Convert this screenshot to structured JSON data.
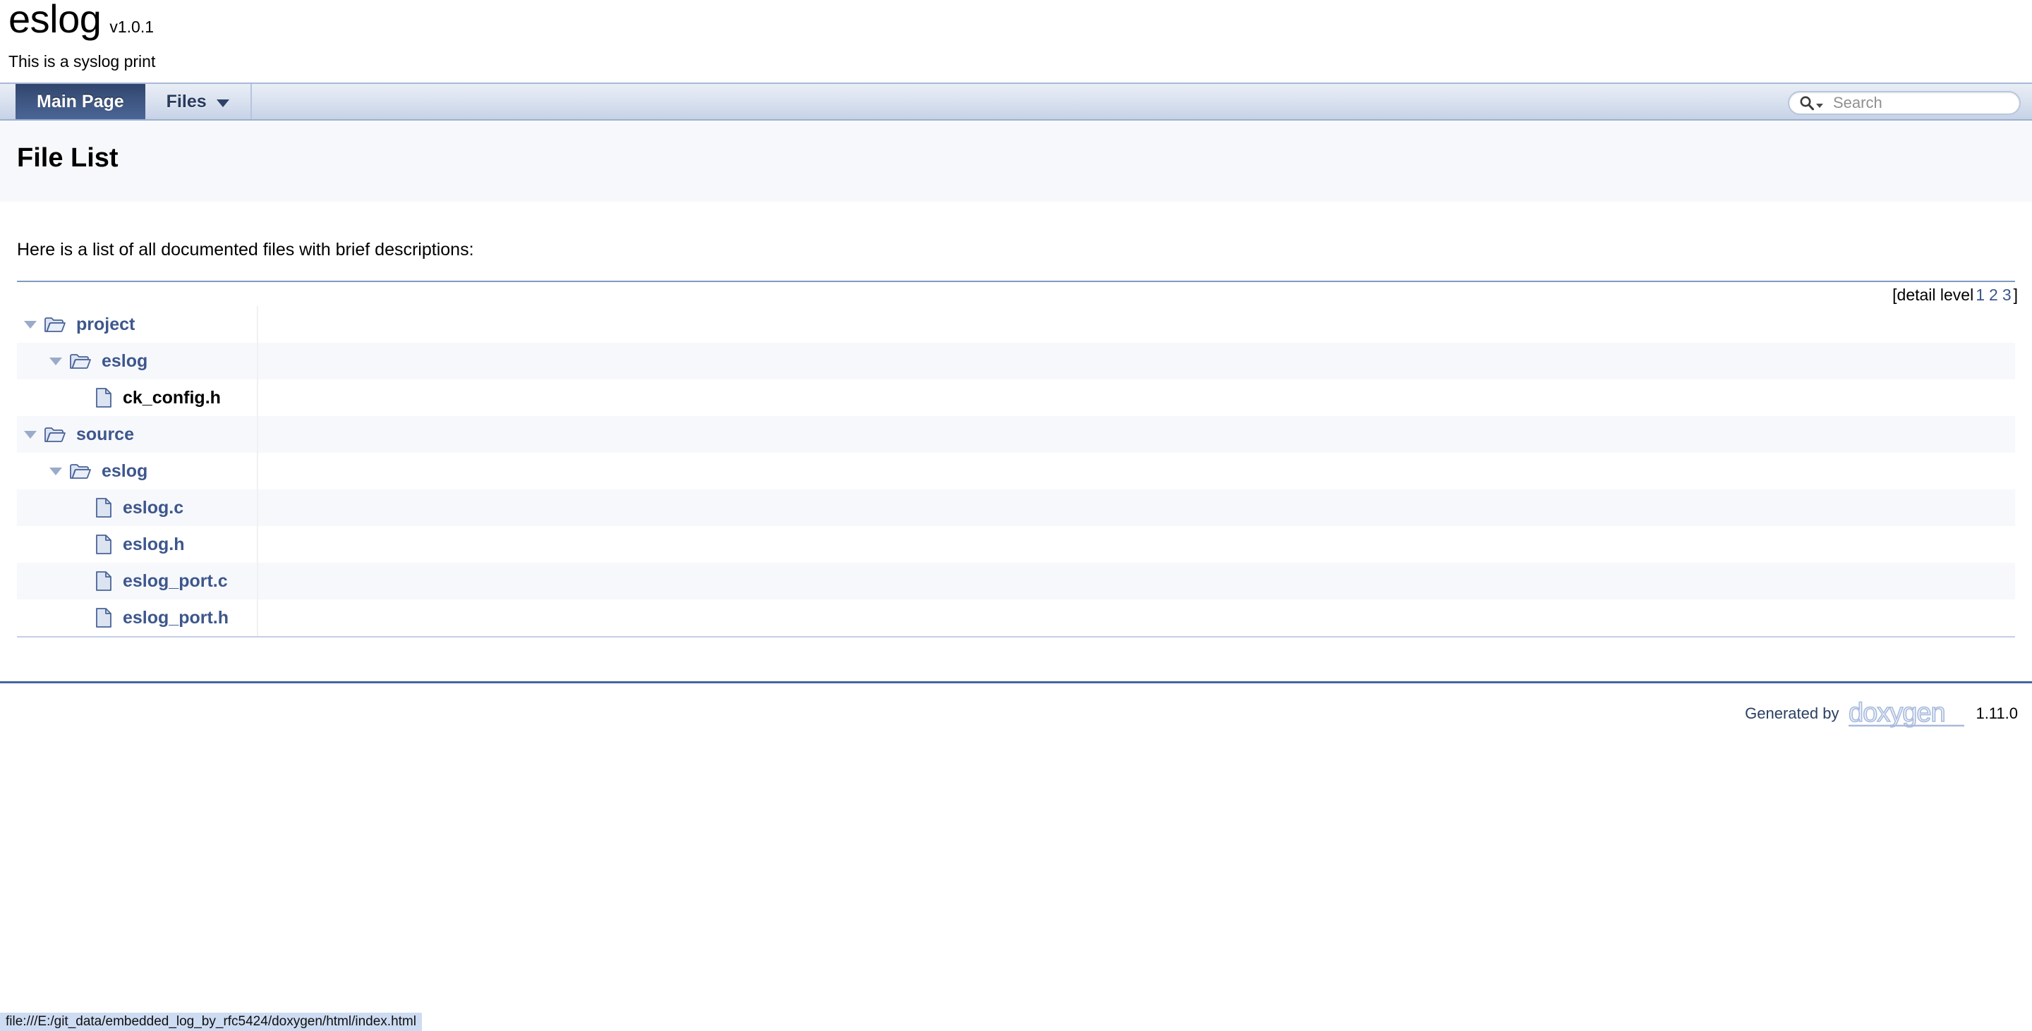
{
  "project": {
    "name": "eslog",
    "version": "v1.0.1",
    "brief": "This is a syslog print"
  },
  "navbar": {
    "tabs": [
      {
        "label": "Main Page",
        "current": true,
        "has_caret": false
      },
      {
        "label": "Files",
        "current": false,
        "has_caret": true
      }
    ],
    "search": {
      "placeholder": "Search",
      "value": "",
      "icon": "search-icon"
    }
  },
  "header": {
    "title": "File List"
  },
  "content": {
    "intro": "Here is a list of all documented files with brief descriptions:",
    "detail_level": {
      "prefix": "[detail level",
      "levels": [
        "1",
        "2",
        "3"
      ],
      "suffix": "]"
    },
    "tree": [
      {
        "label": "project",
        "kind": "folder",
        "icon": "folder-open-icon",
        "indent": 0,
        "expanded": true,
        "link": true,
        "row": "odd"
      },
      {
        "label": "eslog",
        "kind": "folder",
        "icon": "folder-open-icon",
        "indent": 1,
        "expanded": true,
        "link": true,
        "row": "even"
      },
      {
        "label": "ck_config.h",
        "kind": "file",
        "icon": "file-icon",
        "indent": 2,
        "expanded": false,
        "link": false,
        "row": "odd"
      },
      {
        "label": "source",
        "kind": "folder",
        "icon": "folder-open-icon",
        "indent": 0,
        "expanded": true,
        "link": true,
        "row": "even"
      },
      {
        "label": "eslog",
        "kind": "folder",
        "icon": "folder-open-icon",
        "indent": 1,
        "expanded": true,
        "link": true,
        "row": "odd"
      },
      {
        "label": "eslog.c",
        "kind": "file",
        "icon": "file-icon",
        "indent": 2,
        "expanded": false,
        "link": true,
        "row": "even"
      },
      {
        "label": "eslog.h",
        "kind": "file",
        "icon": "file-icon",
        "indent": 2,
        "expanded": false,
        "link": true,
        "row": "odd"
      },
      {
        "label": "eslog_port.c",
        "kind": "file",
        "icon": "file-icon",
        "indent": 2,
        "expanded": false,
        "link": true,
        "row": "even"
      },
      {
        "label": "eslog_port.h",
        "kind": "file",
        "icon": "file-icon",
        "indent": 2,
        "expanded": false,
        "link": true,
        "row": "odd"
      }
    ]
  },
  "footer": {
    "generated_by": "Generated by",
    "logo_text": "doxygen",
    "version": "1.11.0"
  },
  "statusbar": {
    "url": "file:///E:/git_data/embedded_log_by_rfc5424/doxygen/html/index.html"
  },
  "colors": {
    "link": "#3d578c",
    "tab_active_bg": "#3d5580",
    "row_even": "#f7f8fc",
    "header_band": "#f7f8fb",
    "footer_rule": "#4665a2",
    "statusbar_bg": "#cddcf2"
  }
}
